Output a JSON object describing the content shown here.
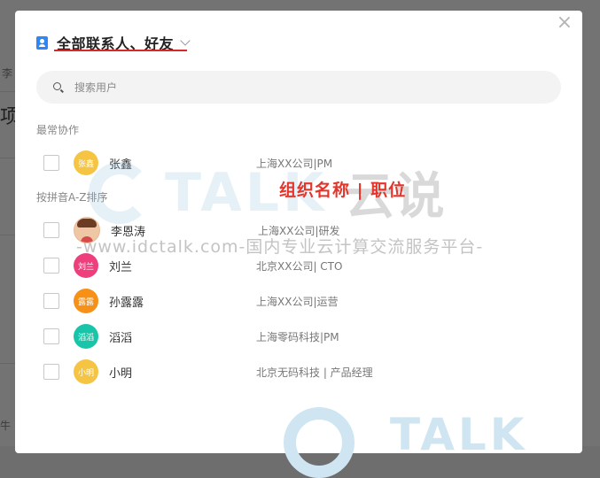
{
  "background": {
    "fragment_1": "李",
    "fragment_2": "项",
    "fragment_3": "牛"
  },
  "dialog": {
    "title": "全部联系人、好友",
    "close_glyph": "×",
    "search": {
      "placeholder": "搜索用户",
      "value": ""
    },
    "sections": {
      "frequent": "最常协作",
      "alphabetical": "按拼音A-Z排序"
    },
    "frequent_contacts": [
      {
        "name": "张鑫",
        "avatar_text": "张鑫",
        "avatar_color": "#f5c443",
        "org": "上海XX公司|PM"
      }
    ],
    "alphabetical_contacts": [
      {
        "name": "李恩涛",
        "avatar_text": "",
        "avatar_color": "#f0c7a4",
        "org": "上海XX公司|研发"
      },
      {
        "name": "刘兰",
        "avatar_text": "刘兰",
        "avatar_color": "#ee3f7c",
        "org": "北京XX公司| CTO"
      },
      {
        "name": "孙露露",
        "avatar_text": "露露",
        "avatar_color": "#f79016",
        "org": "上海XX公司|运营"
      },
      {
        "name": "滔滔",
        "avatar_text": "滔滔",
        "avatar_color": "#18c5a8",
        "org": "上海零码科技|PM"
      },
      {
        "name": "小明",
        "avatar_text": "小明",
        "avatar_color": "#f5c443",
        "org": "北京无码科技 | 产品经理"
      }
    ]
  },
  "annotation": {
    "caption": "组织名称 | 职位"
  },
  "watermark": {
    "talk": "TALK",
    "yunshuo": "云说",
    "url": "-www.idctalk.com-国内专业云计算交流服务平台-",
    "bottom_talk": "TALK"
  }
}
